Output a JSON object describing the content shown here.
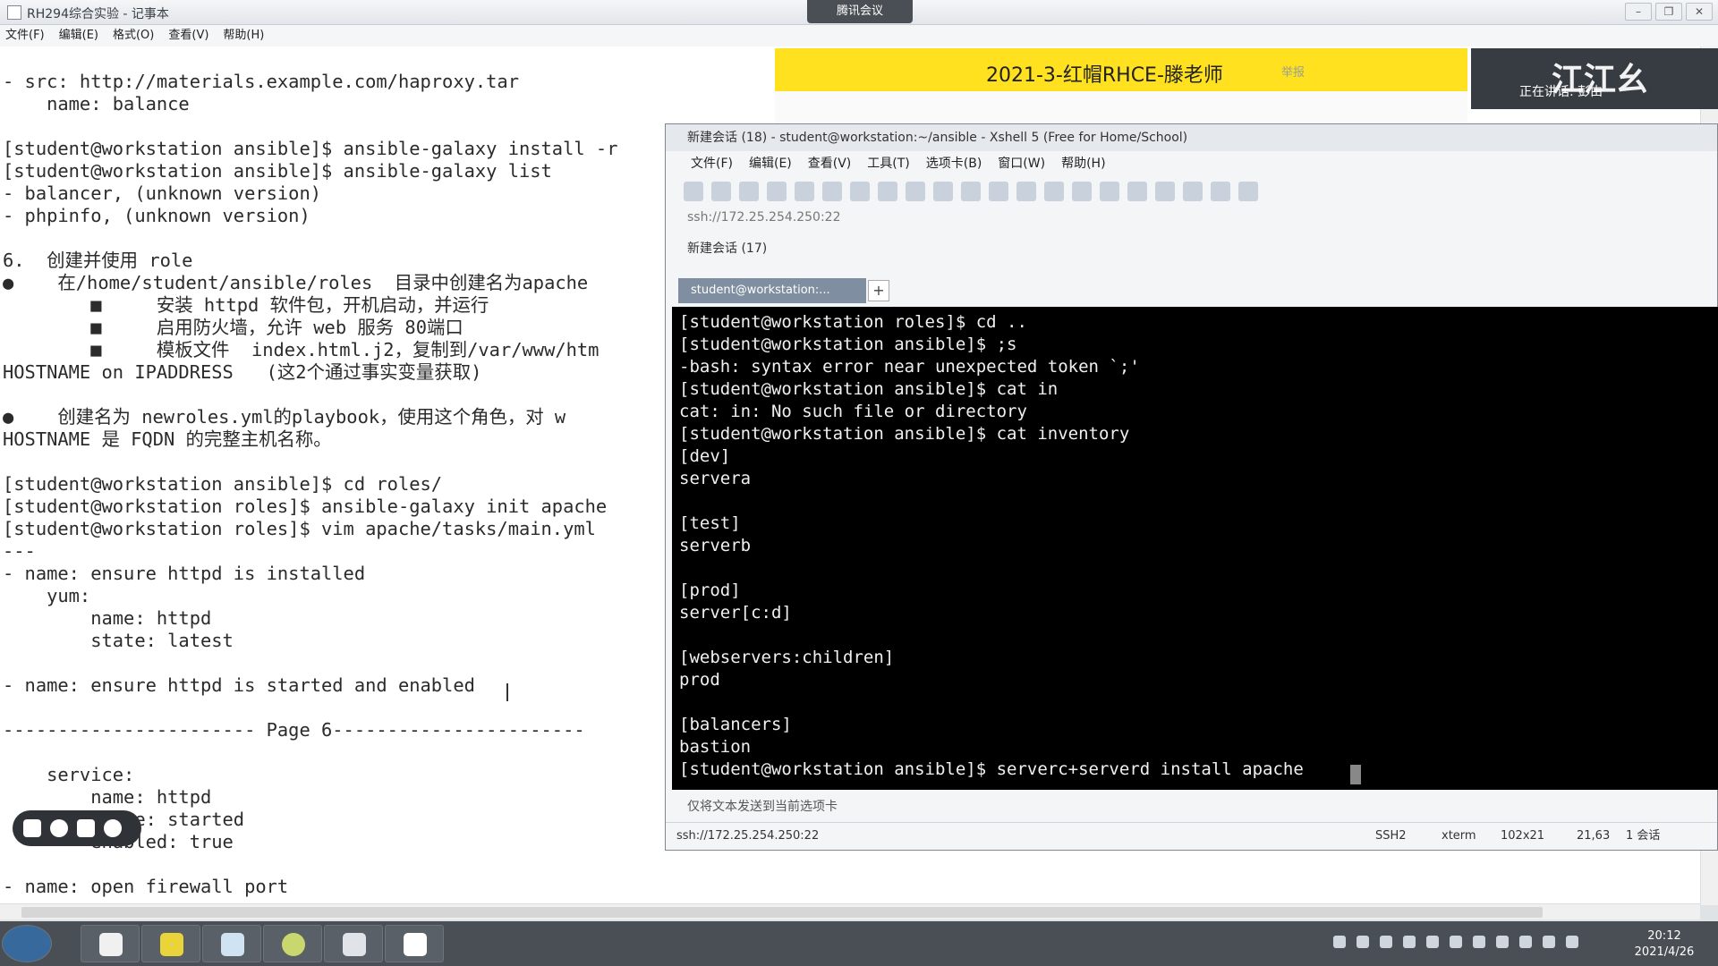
{
  "notepad": {
    "title": "RH294综合实验 - 记事本",
    "menu": [
      "文件(F)",
      "编辑(E)",
      "格式(O)",
      "查看(V)",
      "帮助(H)"
    ],
    "lines": [
      "- src: http://materials.example.com/haproxy.tar",
      "    name: balance",
      "",
      "[student@workstation ansible]$ ansible-galaxy install -r",
      "[student@workstation ansible]$ ansible-galaxy list",
      "- balancer, (unknown version)",
      "- phpinfo, (unknown version)",
      "",
      "6.  创建并使用 role",
      "●    在/home/student/ansible/roles  目录中创建名为apache",
      "        ■     安装 httpd 软件包，开机启动，并运行",
      "        ■     启用防火墙，允许 web 服务 80端口",
      "        ■     模板文件  index.html.j2，复制到/var/www/htm",
      "HOSTNAME on IPADDRESS   (这2个通过事实变量获取)",
      "",
      "●    创建名为 newroles.yml的playbook，使用这个角色，对 w",
      "HOSTNAME 是 FQDN 的完整主机名称。",
      "",
      "[student@workstation ansible]$ cd roles/",
      "[student@workstation roles]$ ansible-galaxy init apache",
      "[student@workstation roles]$ vim apache/tasks/main.yml",
      "---",
      "- name: ensure httpd is installed",
      "    yum:",
      "        name: httpd",
      "        state: latest",
      "",
      "- name: ensure httpd is started and enabled",
      "",
      "----------------------- Page 6-----------------------",
      "",
      "    service:",
      "        name: httpd",
      "        state: started",
      "        enabled: true",
      "",
      "- name: open firewall port"
    ]
  },
  "meeting": {
    "app_label": "腾讯会议",
    "title": "2021-3-红帽RHCE-滕老师",
    "dropdown": "举报",
    "speaker_banner": "江江幺",
    "speaking": "正在讲话: 彭由"
  },
  "xshell": {
    "title": "新建会话 (18) - student@workstation:~/ansible - Xshell 5 (Free for Home/School)",
    "menu": [
      "文件(F)",
      "编辑(E)",
      "查看(V)",
      "工具(T)",
      "选项卡(B)",
      "窗口(W)",
      "帮助(H)"
    ],
    "address": "ssh://172.25.254.250:22",
    "favorite": "新建会话 (17)",
    "tab_label": "student@workstation:...",
    "tab_add": "+",
    "terminal_lines": [
      "[student@workstation roles]$ cd ..",
      "[student@workstation ansible]$ ;s",
      "-bash: syntax error near unexpected token `;'",
      "[student@workstation ansible]$ cat in",
      "cat: in: No such file or directory",
      "[student@workstation ansible]$ cat inventory",
      "[dev]",
      "servera",
      "",
      "[test]",
      "serverb",
      "",
      "[prod]",
      "server[c:d]",
      "",
      "[webservers:children]",
      "prod",
      "",
      "[balancers]",
      "bastion",
      "[student@workstation ansible]$ serverc+serverd install apache "
    ],
    "send_bar": "仅将文本发送到当前选项卡",
    "status": {
      "address": "ssh://172.25.254.250:22",
      "protocol": "SSH2",
      "term": "xterm",
      "size": "102x21",
      "cursor": "21,63",
      "sessions": "1 会话"
    }
  },
  "taskbar": {
    "time": "20:12",
    "date": "2021/4/26"
  }
}
